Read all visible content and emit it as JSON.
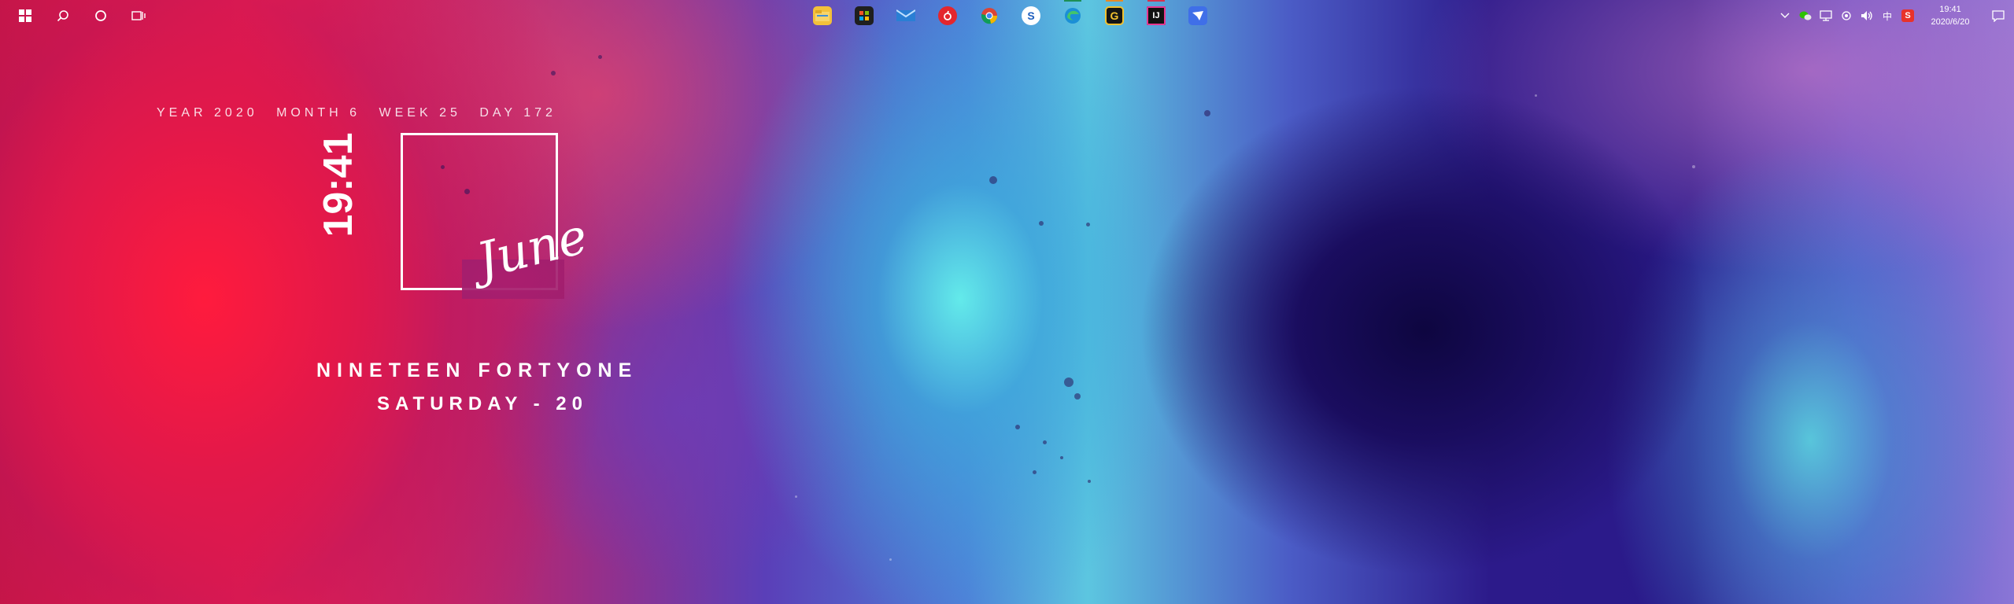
{
  "widget": {
    "year_label": "YEAR 2020",
    "month_label": "MONTH 6",
    "week_label": "WEEK 25",
    "day_label": "DAY 172",
    "time": "19:41",
    "month_name": "June",
    "time_words": "NINETEEN FORTYONE",
    "weekday_line": "SATURDAY - 20"
  },
  "taskbar": {
    "left_icons": [
      "windows-start-icon",
      "search-icon",
      "cortana-icon",
      "task-view-icon"
    ],
    "apps": [
      {
        "name": "file-explorer",
        "glyph": "▬",
        "color": "#f3c13a",
        "underline": ""
      },
      {
        "name": "microsoft-store",
        "glyph": "▦",
        "color": "#1f1f1f",
        "underline": ""
      },
      {
        "name": "mail",
        "glyph": "✉",
        "color": "#2a7fd4",
        "underline": ""
      },
      {
        "name": "netease-music",
        "glyph": "◎",
        "color": "#e4262d",
        "underline": ""
      },
      {
        "name": "chrome",
        "glyph": "◉",
        "color": "#2e9e4a",
        "underline": ""
      },
      {
        "name": "sogou-browser",
        "glyph": "S",
        "color": "#1e5fbf",
        "underline": ""
      },
      {
        "name": "edge",
        "glyph": "e",
        "color": "#1b8fd6",
        "underline": "#1e8f55"
      },
      {
        "name": "g-app",
        "glyph": "G",
        "color": "#151515",
        "underline": "#e58a28"
      },
      {
        "name": "intellij",
        "glyph": "IJ",
        "color": "#111111",
        "underline": "#d6324d"
      },
      {
        "name": "feishu",
        "glyph": "✈",
        "color": "#3f6fe8",
        "underline": ""
      }
    ],
    "tray_icons": [
      "chevron-up-icon",
      "wechat-icon",
      "network-icon",
      "settings-tray-icon",
      "volume-icon",
      "ime-icon",
      "sogou-input-icon"
    ],
    "ime_label": "中",
    "clock_time": "19:41",
    "clock_date": "2020/6/20",
    "notification_icon": "action-center-icon"
  }
}
